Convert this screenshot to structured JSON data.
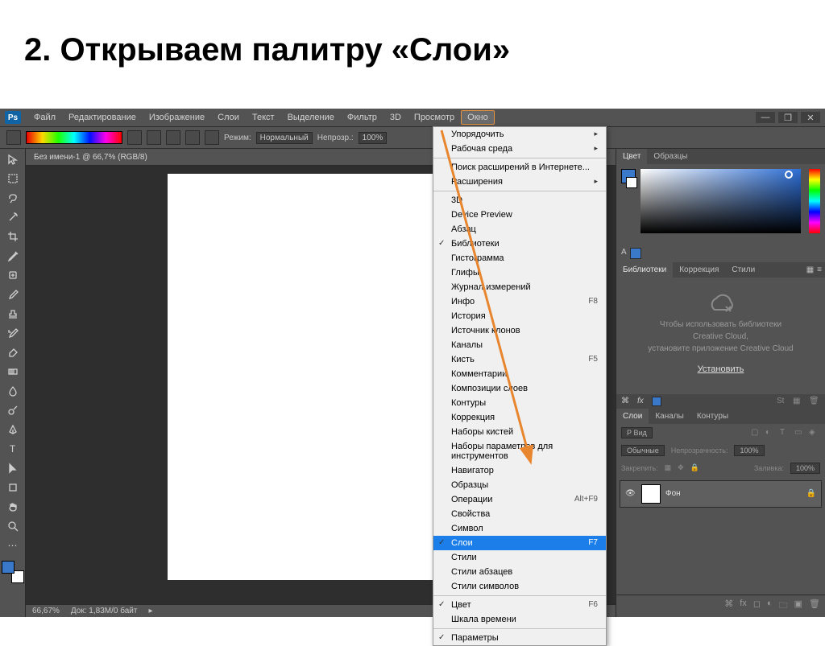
{
  "slide": {
    "title": "2. Открываем палитру «Слои»"
  },
  "menubar": {
    "items": [
      "Файл",
      "Редактирование",
      "Изображение",
      "Слои",
      "Текст",
      "Выделение",
      "Фильтр",
      "3D",
      "Просмотр",
      "Окно"
    ],
    "active_index": 9
  },
  "options": {
    "mode_label": "Режим:",
    "mode_value": "Нормальный",
    "opacity_label": "Непрозр.:",
    "opacity_value": "100%"
  },
  "doc": {
    "tab_title": "Без имени-1 @ 66,7% (RGB/8)",
    "zoom": "66,67%",
    "info": "Док: 1,83M/0 байт"
  },
  "dropdown": [
    {
      "label": "Упорядочить",
      "sub": true
    },
    {
      "label": "Рабочая среда",
      "sub": true
    },
    {
      "sep": true
    },
    {
      "label": "Поиск расширений в Интернете..."
    },
    {
      "label": "Расширения",
      "sub": true
    },
    {
      "sep": true
    },
    {
      "label": "3D"
    },
    {
      "label": "Device Preview"
    },
    {
      "label": "Абзац"
    },
    {
      "label": "Библиотеки",
      "checked": true
    },
    {
      "label": "Гистограмма"
    },
    {
      "label": "Глифы"
    },
    {
      "label": "Журнал измерений"
    },
    {
      "label": "Инфо",
      "shortcut": "F8"
    },
    {
      "label": "История"
    },
    {
      "label": "Источник клонов"
    },
    {
      "label": "Каналы"
    },
    {
      "label": "Кисть",
      "shortcut": "F5"
    },
    {
      "label": "Комментарии"
    },
    {
      "label": "Композиции слоев"
    },
    {
      "label": "Контуры"
    },
    {
      "label": "Коррекция"
    },
    {
      "label": "Наборы кистей"
    },
    {
      "label": "Наборы параметров для инструментов"
    },
    {
      "label": "Навигатор"
    },
    {
      "label": "Образцы"
    },
    {
      "label": "Операции",
      "shortcut": "Alt+F9"
    },
    {
      "label": "Свойства"
    },
    {
      "label": "Символ"
    },
    {
      "label": "Слои",
      "shortcut": "F7",
      "checked": true,
      "selected": true
    },
    {
      "label": "Стили"
    },
    {
      "label": "Стили абзацев"
    },
    {
      "label": "Стили символов"
    },
    {
      "sep": true
    },
    {
      "label": "Цвет",
      "shortcut": "F6",
      "checked": true
    },
    {
      "label": "Шкала времени"
    },
    {
      "sep": true
    },
    {
      "label": "Параметры",
      "checked": true
    }
  ],
  "panels": {
    "color_tabs": [
      "Цвет",
      "Образцы"
    ],
    "lib_tabs": [
      "Библиотеки",
      "Коррекция",
      "Стили"
    ],
    "lib_text1": "Чтобы использовать библиотеки",
    "lib_text2": "Creative Cloud,",
    "lib_text3": "установите приложение Creative Cloud",
    "install": "Установить",
    "layers": {
      "tabs": [
        "Слои",
        "Каналы",
        "Контуры"
      ],
      "kind": "Р Вид",
      "mode": "Обычные",
      "opacity_label": "Непрозрачность:",
      "opacity": "100%",
      "lock_label": "Закрепить:",
      "fill_label": "Заливка:",
      "fill": "100%",
      "layer_name": "Фон"
    }
  }
}
